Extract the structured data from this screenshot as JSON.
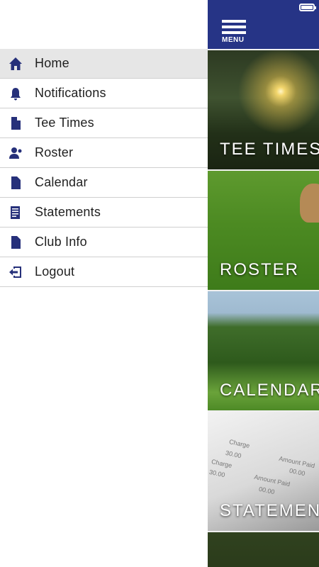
{
  "drawer": {
    "items": [
      {
        "label": "Home",
        "icon": "home-icon",
        "active": true
      },
      {
        "label": "Notifications",
        "icon": "bell-icon",
        "active": false
      },
      {
        "label": "Tee Times",
        "icon": "document-icon",
        "active": false
      },
      {
        "label": "Roster",
        "icon": "person-icon",
        "active": false
      },
      {
        "label": "Calendar",
        "icon": "document-icon",
        "active": false
      },
      {
        "label": "Statements",
        "icon": "statement-icon",
        "active": false
      },
      {
        "label": "Club Info",
        "icon": "document-icon",
        "active": false
      },
      {
        "label": "Logout",
        "icon": "logout-icon",
        "active": false
      }
    ]
  },
  "topbar": {
    "menu_label": "MENU",
    "color": "#263486"
  },
  "tiles": [
    {
      "label": "TEE TIMES"
    },
    {
      "label": "ROSTER"
    },
    {
      "label": "CALENDAR"
    },
    {
      "label": "STATEMENTS"
    }
  ],
  "statement_image": {
    "charge_1": "Charge",
    "amount_1": "30.00",
    "amount_paid_1": "Amount Paid",
    "value_1": "00.00",
    "charge_2": "Charge",
    "amount_2": "30.00",
    "amount_paid_2": "Amount Paid",
    "value_2": "00.00"
  },
  "colors": {
    "accent": "#263486",
    "icon": "#26307a",
    "active_row": "#e6e6e6"
  }
}
